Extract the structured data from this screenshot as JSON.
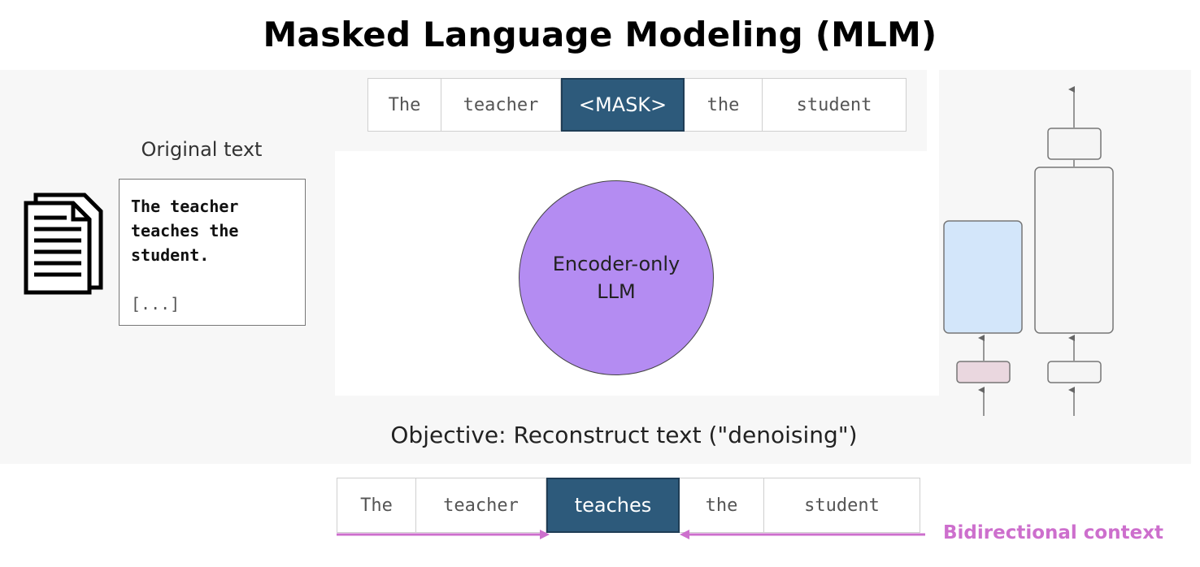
{
  "title": "Masked Language Modeling (MLM)",
  "masked_tokens": [
    "The",
    "teacher",
    "<MASK>",
    "the",
    "student"
  ],
  "original_text": {
    "label": "Original text",
    "content": "The teacher\nteaches the\nstudent.",
    "ellipsis": "[...]"
  },
  "model": {
    "line1": "Encoder-only",
    "line2": "LLM"
  },
  "objective": "Objective: Reconstruct text (\"denoising\")",
  "reconstructed_tokens": [
    "The",
    "teacher",
    "teaches",
    "the",
    "student"
  ],
  "bidirectional_label": "Bidirectional context",
  "colors": {
    "highlight_token": "#2d5a7b",
    "model_circle": "#b48cf2",
    "bidirectional_arrow": "#cd6fcd",
    "encoder_block": "#d3e6fa",
    "embedding_block": "#ead7df"
  }
}
